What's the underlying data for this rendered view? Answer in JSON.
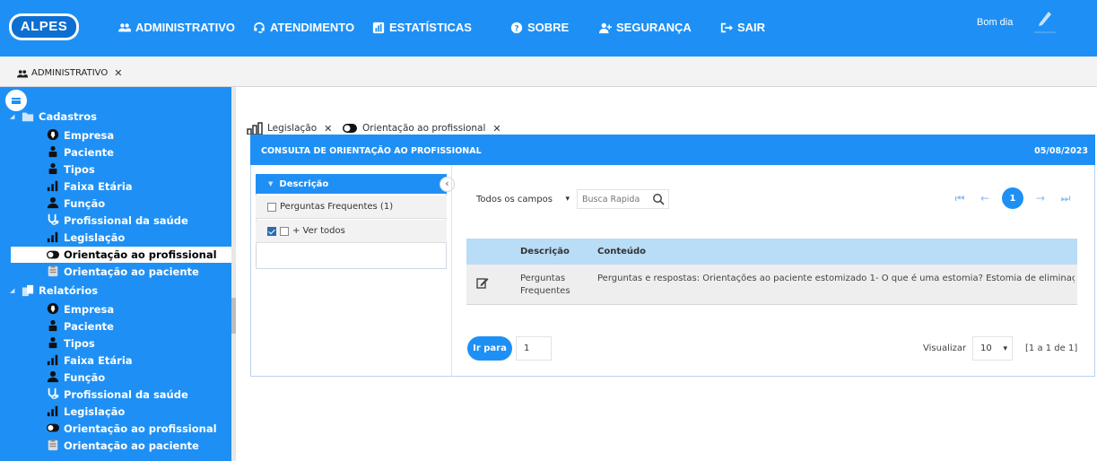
{
  "app": {
    "logo": "ALPES",
    "greeting": "Bom dia"
  },
  "topnav": [
    {
      "label": "ADMINISTRATIVO",
      "icon": "users-icon"
    },
    {
      "label": "ATENDIMENTO",
      "icon": "headset-icon"
    },
    {
      "label": "ESTATÍSTICAS",
      "icon": "chart-icon"
    },
    {
      "label": "SOBRE",
      "icon": "question-icon"
    },
    {
      "label": "SEGURANÇA",
      "icon": "user-plus-icon"
    },
    {
      "label": "SAIR",
      "icon": "sign-out-icon"
    }
  ],
  "module_tab": {
    "label": "ADMINISTRATIVO",
    "close": "✕"
  },
  "sidebar": {
    "groups": [
      {
        "label": "Cadastros",
        "toggle": "◢",
        "items": [
          {
            "label": "Empresa",
            "icon": "map-marker-icon"
          },
          {
            "label": "Paciente",
            "icon": "person-icon"
          },
          {
            "label": "Tipos",
            "icon": "person-icon"
          },
          {
            "label": "Faixa Etária",
            "icon": "bar-chart-icon"
          },
          {
            "label": "Função",
            "icon": "user-icon"
          },
          {
            "label": "Profissional da saúde",
            "icon": "stethoscope-icon"
          },
          {
            "label": "Legislação",
            "icon": "bar-chart-icon"
          },
          {
            "label": "Orientação ao profissional",
            "icon": "toggle-icon",
            "selected": true
          },
          {
            "label": "Orientação ao paciente",
            "icon": "clipboard-icon"
          }
        ]
      },
      {
        "label": "Relatórios",
        "toggle": "◢",
        "items": [
          {
            "label": "Empresa",
            "icon": "map-marker-icon"
          },
          {
            "label": "Paciente",
            "icon": "person-icon"
          },
          {
            "label": "Tipos",
            "icon": "person-icon"
          },
          {
            "label": "Faixa Etária",
            "icon": "bar-chart-icon"
          },
          {
            "label": "Função",
            "icon": "user-icon"
          },
          {
            "label": "Profissional da saúde",
            "icon": "stethoscope-icon"
          },
          {
            "label": "Legislação",
            "icon": "bar-chart-icon"
          },
          {
            "label": "Orientação ao profissional",
            "icon": "toggle-icon"
          },
          {
            "label": "Orientação ao paciente",
            "icon": "clipboard-icon"
          }
        ]
      }
    ]
  },
  "content_tabs": [
    {
      "label": "Legislação",
      "icon": "bar-chart-icon",
      "close": "✕"
    },
    {
      "label": "Orientação ao profissional",
      "icon": "toggle-icon",
      "close": "✕",
      "active": true
    }
  ],
  "panel": {
    "title": "CONSULTA DE ORIENTAÇÃO AO PROFISSIONAL",
    "date": "05/08/2023",
    "filter": {
      "header": "Descrição",
      "caret": "▼",
      "collapse": "‹",
      "options": [
        {
          "label": "Perguntas Frequentes (1)",
          "checked": false
        },
        {
          "label": "+ Ver todos",
          "checked": true
        }
      ]
    },
    "search": {
      "field_select": "Todos os campos",
      "placeholder": "Busca Rapida"
    },
    "pagination": {
      "first": "⏮",
      "prev": "←",
      "current": "1",
      "next": "→",
      "last": "⏭"
    },
    "table": {
      "columns": [
        "",
        "Descrição",
        "Conteúdo"
      ],
      "rows": [
        {
          "descricao_line1": "Perguntas",
          "descricao_line2": "Frequentes",
          "conteudo": "Perguntas e respostas: Orientações ao paciente estomizado 1-   O que é uma estomia? Estomia de eliminaç&_"
        }
      ]
    },
    "footer": {
      "goto_label": "Ir para",
      "goto_value": "1",
      "view_label": "Visualizar",
      "page_size": "10",
      "range": "[1 a 1 de 1]"
    }
  },
  "colors": {
    "primary": "#1e90f5",
    "table_header": "#b9dcf7",
    "row_bg": "#eeeeee"
  }
}
